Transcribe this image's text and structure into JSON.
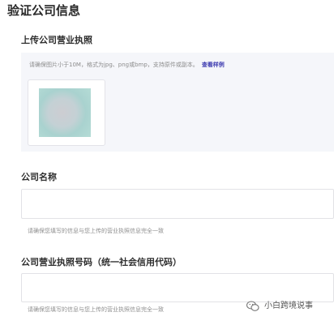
{
  "page": {
    "title": "验证公司信息"
  },
  "upload": {
    "label": "上传公司营业执照",
    "hint": "请确保图片小于10M，格式为jpg、png或bmp，支持原件或副本。",
    "view_example": "查看样例"
  },
  "company_name": {
    "label": "公司名称",
    "value": "",
    "hint": "请确保您填写的信息与您上传的营业执照信息完全一致"
  },
  "license_number": {
    "label": "公司营业执照号码（统一社会信用代码）",
    "value": "",
    "hint": "请确保您填写的信息与您上传的营业执照信息完全一致"
  },
  "watermark": {
    "icon": "wechat-icon",
    "text": "小白跨境说事"
  }
}
